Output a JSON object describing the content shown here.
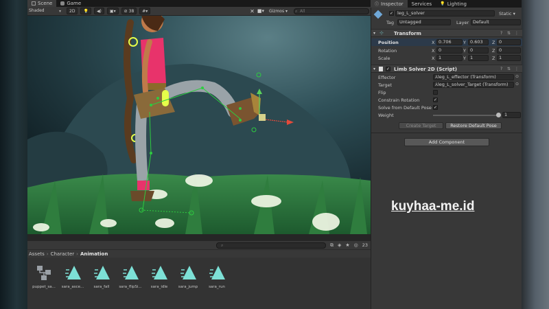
{
  "scene_tabs": {
    "scene": "Scene",
    "game": "Game"
  },
  "toolbar": {
    "shaded": "Shaded",
    "mode_2d": "2D",
    "hidden_count": "38",
    "gizmos": "Gizmos",
    "search_placeholder": "All"
  },
  "inspector_tabs": {
    "inspector": "Inspector",
    "services": "Services",
    "lighting": "Lighting"
  },
  "gameobject": {
    "name": "leg_L_solver",
    "static": "Static",
    "tag_label": "Tag",
    "tag_value": "Untagged",
    "layer_label": "Layer",
    "layer_value": "Default"
  },
  "transform": {
    "title": "Transform",
    "position_label": "Position",
    "rotation_label": "Rotation",
    "scale_label": "Scale",
    "pos": {
      "x": "0.706",
      "y": "0.603",
      "z": "0"
    },
    "rot": {
      "x": "0",
      "y": "0",
      "z": "0"
    },
    "scl": {
      "x": "1",
      "y": "1",
      "z": "1"
    }
  },
  "limb_solver": {
    "title": "Limb Solver 2D (Script)",
    "effector_label": "Effector",
    "effector_value": "leg_L_effector (Transform)",
    "target_label": "Target",
    "target_value": "leg_L_solver_Target (Transform)",
    "flip_label": "Flip",
    "constrain_label": "Constrain Rotation",
    "solve_label": "Solve from Default Pose",
    "weight_label": "Weight",
    "weight_value": "1",
    "create_target": "Create Target",
    "restore_pose": "Restore Default Pose"
  },
  "add_component": "Add Component",
  "project": {
    "breadcrumb": [
      "Assets",
      "Character",
      "Animation"
    ],
    "asset_count": "23",
    "assets": [
      {
        "label": "puppet_sa...",
        "type": "animator"
      },
      {
        "label": "sara_asce...",
        "type": "anim"
      },
      {
        "label": "sara_fall",
        "type": "anim"
      },
      {
        "label": "sara_flipSi...",
        "type": "anim"
      },
      {
        "label": "sara_idle",
        "type": "anim"
      },
      {
        "label": "sara_jump",
        "type": "anim"
      },
      {
        "label": "sara_run",
        "type": "anim"
      }
    ]
  },
  "watermark": "kuyhaa-me.id",
  "colors": {
    "gizmo_green": "#2ecc40",
    "anim_icon": "#7de0d6",
    "pink_shirt": "#e8336b"
  }
}
